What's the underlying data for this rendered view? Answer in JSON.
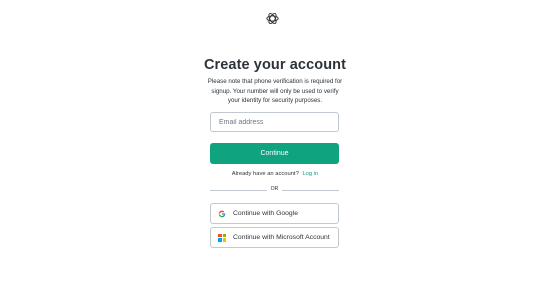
{
  "header": {
    "logo_icon": "openai-logo-icon"
  },
  "main": {
    "title": "Create your account",
    "subtitle": "Please note that phone verification is required for signup. Your number will only be used to verify your identity for security purposes.",
    "email": {
      "placeholder": "Email address",
      "value": ""
    },
    "continue_label": "Continue",
    "login_prompt": "Already have an account?",
    "login_link": "Log in",
    "divider_text": "OR",
    "social": [
      {
        "label": "Continue with Google",
        "icon": "google-icon"
      },
      {
        "label": "Continue with Microsoft Account",
        "icon": "microsoft-icon"
      }
    ]
  },
  "colors": {
    "accent": "#10a37f",
    "text": "#2d333a",
    "border": "#c2c8d0",
    "microsoft": [
      "#f25022",
      "#7fba00",
      "#00a4ef",
      "#ffb900"
    ],
    "google": [
      "#4285f4",
      "#34a853",
      "#fbbc05",
      "#ea4335"
    ]
  }
}
